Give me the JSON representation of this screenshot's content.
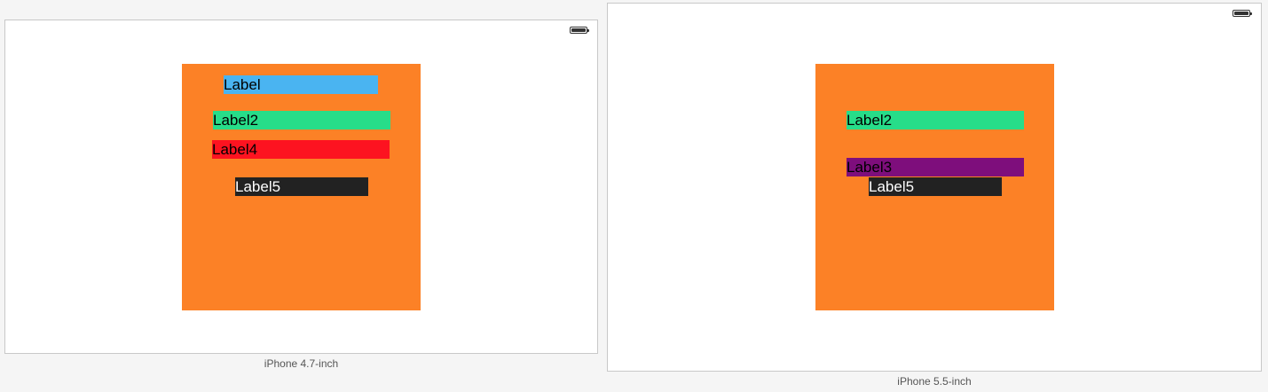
{
  "colors": {
    "container": "#fc8126",
    "blue": "#4ab4f1",
    "green": "#27dd89",
    "red": "#fd1320",
    "purple": "#7e0e7c",
    "dark": "#222222"
  },
  "devices": [
    {
      "caption": "iPhone 4.7-inch",
      "labels": {
        "label": "Label",
        "label2": "Label2",
        "label4": "Label4",
        "label5": "Label5"
      }
    },
    {
      "caption": "iPhone 5.5-inch",
      "labels": {
        "label2": "Label2",
        "label3": "Label3",
        "label5": "Label5"
      }
    }
  ]
}
